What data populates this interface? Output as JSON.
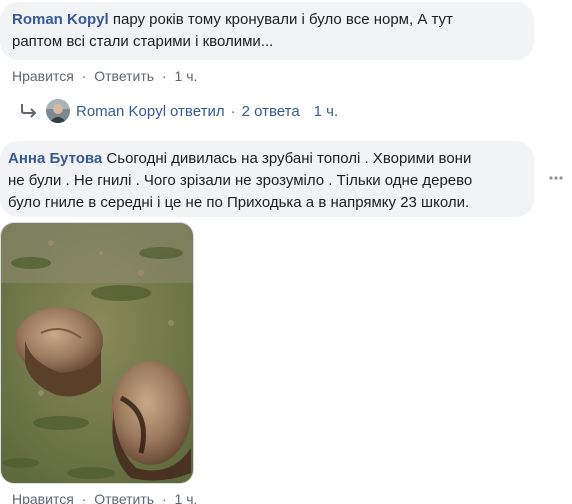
{
  "comment1": {
    "author": "Roman Kopyl",
    "text_line1": "пару років тому кронували і було все норм, А тут",
    "text_line2": "раптом всі стали старими і кволими...",
    "like": "Нравится",
    "reply": "Ответить",
    "time": "1 ч."
  },
  "replies": {
    "author": "Roman Kopyl",
    "answered": "ответил",
    "separator": "·",
    "count": "2 ответа",
    "time": "1 ч."
  },
  "comment2": {
    "author": "Анна Бутова",
    "text_line1": "Сьогодні дивилась на зрубані тополі . Хворими вони",
    "text_line2": "не були . Не гнилі . Чого зрізали не зрозуміло . Тільки одне дерево",
    "text_line3": "було гниле в середні і це не по Приходька а в напрямку 23 школи.",
    "like": "Нравится",
    "reply": "Ответить",
    "time": "1 ч."
  },
  "separator": "·",
  "icons": {
    "reply_arrow": "reply-arrow-icon",
    "more": "more-options-icon"
  },
  "colors": {
    "link": "#385898",
    "meta": "#606770",
    "bubble": "#f2f3f5"
  }
}
